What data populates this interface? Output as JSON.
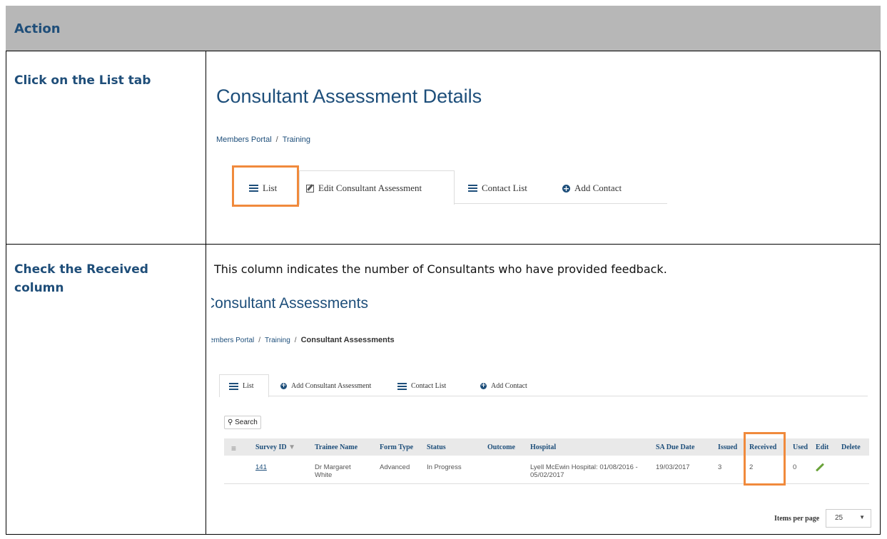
{
  "header": {
    "title": "Action"
  },
  "rows": [
    {
      "action": "Click on the List tab"
    },
    {
      "action": "Check the Received column"
    }
  ],
  "shot1": {
    "title": "Consultant Assessment Details",
    "breadcrumb": [
      "Members Portal",
      "Training"
    ],
    "tabs": [
      "List",
      "Edit Consultant Assessment",
      "Contact List",
      "Add Contact"
    ]
  },
  "description": "This column indicates the number of Consultants who have provided feedback.",
  "shot2": {
    "title": "Consultant Assessments",
    "title_clipped": "Consultant Assessments",
    "breadcrumb": [
      "embers Portal",
      "Training",
      "Consultant Assessments"
    ],
    "tabs": [
      "List",
      "Add Consultant Assessment",
      "Contact List",
      "Add Contact"
    ],
    "search_label": "Search",
    "columns": [
      "Survey ID",
      "Trainee Name",
      "Form Type",
      "Status",
      "Outcome",
      "Hospital",
      "SA Due Date",
      "Issued",
      "Received",
      "Used",
      "Edit",
      "Delete"
    ],
    "rows": [
      {
        "survey_id": "141",
        "trainee_line1": "Dr Margaret",
        "trainee_line2": "White",
        "form_type": "Advanced",
        "status": "In Progress",
        "outcome": "",
        "hospital_line1": "Lyell McEwin Hospital: 01/08/2016 -",
        "hospital_line2": "05/02/2017",
        "sa_due_date": "19/03/2017",
        "issued": "3",
        "received": "2",
        "used": "0"
      }
    ],
    "items_per_page_label": "Items per page",
    "items_per_page_value": "25"
  },
  "colors": {
    "highlight": "#f08a3c",
    "header_bg": "#b7b7b7",
    "brand": "#1d4e7a"
  }
}
